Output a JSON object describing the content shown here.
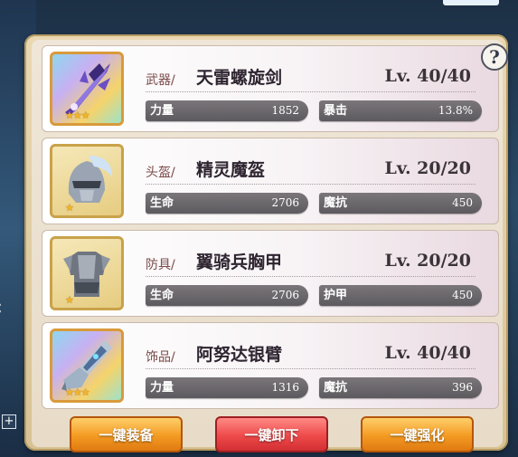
{
  "help": {
    "label": "?"
  },
  "items": [
    {
      "type": "武器/",
      "name": "天雷螺旋剑",
      "level": "Lv. 40/40",
      "stars": "★★★",
      "stats": [
        {
          "name": "力量",
          "value": "1852"
        },
        {
          "name": "暴击",
          "value": "13.8%"
        }
      ],
      "icon": "sword-icon"
    },
    {
      "type": "头盔/",
      "name": "精灵魔盔",
      "level": "Lv. 20/20",
      "stars": "★",
      "stats": [
        {
          "name": "生命",
          "value": "2706"
        },
        {
          "name": "魔抗",
          "value": "450"
        }
      ],
      "icon": "helmet-icon"
    },
    {
      "type": "防具/",
      "name": "翼骑兵胸甲",
      "level": "Lv. 20/20",
      "stars": "★",
      "stats": [
        {
          "name": "生命",
          "value": "2706"
        },
        {
          "name": "护甲",
          "value": "450"
        }
      ],
      "icon": "chest-armor-icon"
    },
    {
      "type": "饰品/",
      "name": "阿努达银臂",
      "level": "Lv. 40/40",
      "stars": "★★★",
      "stats": [
        {
          "name": "力量",
          "value": "1316"
        },
        {
          "name": "魔抗",
          "value": "396"
        }
      ],
      "icon": "gauntlet-icon"
    }
  ],
  "buttons": {
    "equip_all": "一键装备",
    "unequip_all": "一键卸下",
    "enhance_all": "一键强化"
  },
  "colors": {
    "panel": "#e9d8b2",
    "orange_button": "#f39a22",
    "red_button": "#ee4a4a",
    "stat_bar": "#6b676c"
  }
}
